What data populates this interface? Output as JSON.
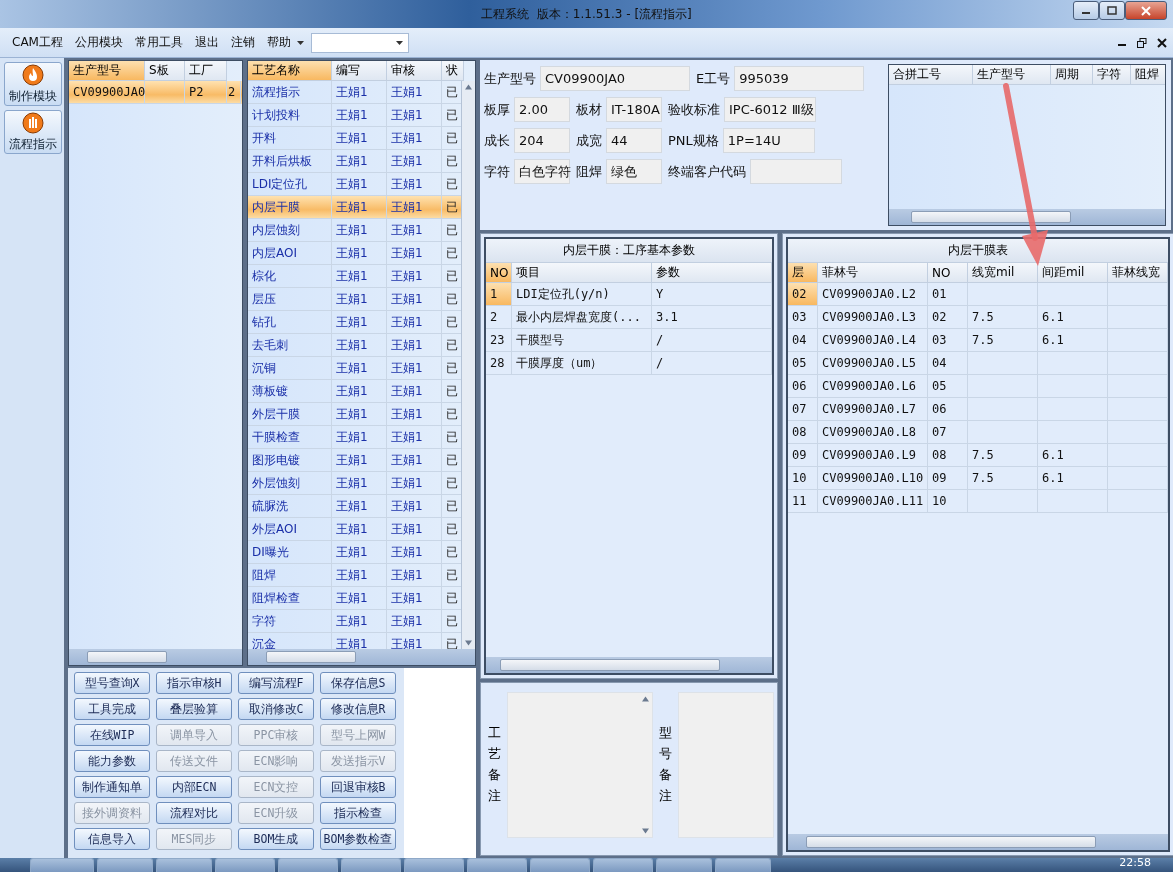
{
  "window": {
    "title": "工程系统  版本：1.1.51.3 - [流程指示]"
  },
  "menu": [
    "CAM工程",
    "公用模块",
    "常用工具",
    "退出",
    "注销",
    "帮助"
  ],
  "sidebar": [
    {
      "label": "制作模块"
    },
    {
      "label": "流程指示"
    }
  ],
  "model_grid": {
    "columns": [
      "生产型号",
      "S板",
      "工厂"
    ],
    "rows": [
      {
        "cells": [
          "CV09900JA0",
          "",
          "P2",
          "2"
        ],
        "selected": true
      }
    ]
  },
  "process_grid": {
    "columns": [
      "工艺名称",
      "编写",
      "审核",
      "状"
    ],
    "rows": [
      {
        "cells": [
          "流程指示",
          "王娟1",
          "王娟1",
          "已"
        ],
        "selected": false
      },
      {
        "cells": [
          "计划投料",
          "王娟1",
          "王娟1",
          "已"
        ],
        "selected": false
      },
      {
        "cells": [
          "开料",
          "王娟1",
          "王娟1",
          "已"
        ],
        "selected": false
      },
      {
        "cells": [
          "开料后烘板",
          "王娟1",
          "王娟1",
          "已"
        ],
        "selected": false
      },
      {
        "cells": [
          "LDI定位孔",
          "王娟1",
          "王娟1",
          "已"
        ],
        "selected": false
      },
      {
        "cells": [
          "内层干膜",
          "王娟1",
          "王娟1",
          "已"
        ],
        "selected": true
      },
      {
        "cells": [
          "内层蚀刻",
          "王娟1",
          "王娟1",
          "已"
        ],
        "selected": false
      },
      {
        "cells": [
          "内层AOI",
          "王娟1",
          "王娟1",
          "已"
        ],
        "selected": false
      },
      {
        "cells": [
          "棕化",
          "王娟1",
          "王娟1",
          "已"
        ],
        "selected": false
      },
      {
        "cells": [
          "层压",
          "王娟1",
          "王娟1",
          "已"
        ],
        "selected": false
      },
      {
        "cells": [
          "钻孔",
          "王娟1",
          "王娟1",
          "已"
        ],
        "selected": false
      },
      {
        "cells": [
          "去毛刺",
          "王娟1",
          "王娟1",
          "已"
        ],
        "selected": false
      },
      {
        "cells": [
          "沉铜",
          "王娟1",
          "王娟1",
          "已"
        ],
        "selected": false
      },
      {
        "cells": [
          "薄板镀",
          "王娟1",
          "王娟1",
          "已"
        ],
        "selected": false
      },
      {
        "cells": [
          "外层干膜",
          "王娟1",
          "王娟1",
          "已"
        ],
        "selected": false
      },
      {
        "cells": [
          "干膜检查",
          "王娟1",
          "王娟1",
          "已"
        ],
        "selected": false
      },
      {
        "cells": [
          "图形电镀",
          "王娟1",
          "王娟1",
          "已"
        ],
        "selected": false
      },
      {
        "cells": [
          "外层蚀刻",
          "王娟1",
          "王娟1",
          "已"
        ],
        "selected": false
      },
      {
        "cells": [
          "硫脲洗",
          "王娟1",
          "王娟1",
          "已"
        ],
        "selected": false
      },
      {
        "cells": [
          "外层AOI",
          "王娟1",
          "王娟1",
          "已"
        ],
        "selected": false
      },
      {
        "cells": [
          "DI曝光",
          "王娟1",
          "王娟1",
          "已"
        ],
        "selected": false
      },
      {
        "cells": [
          "阻焊",
          "王娟1",
          "王娟1",
          "已"
        ],
        "selected": false
      },
      {
        "cells": [
          "阻焊检查",
          "王娟1",
          "王娟1",
          "已"
        ],
        "selected": false
      },
      {
        "cells": [
          "字符",
          "王娟1",
          "王娟1",
          "已"
        ],
        "selected": false
      },
      {
        "cells": [
          "沉金",
          "王娟1",
          "王娟1",
          "已"
        ],
        "selected": false
      }
    ]
  },
  "buttons": [
    {
      "label": "型号查询X",
      "disabled": false
    },
    {
      "label": "指示审核H",
      "disabled": false
    },
    {
      "label": "编写流程F",
      "disabled": false
    },
    {
      "label": "保存信息S",
      "disabled": false
    },
    {
      "label": "工具完成",
      "disabled": false
    },
    {
      "label": "叠层验算",
      "disabled": false
    },
    {
      "label": "取消修改C",
      "disabled": false
    },
    {
      "label": "修改信息R",
      "disabled": false
    },
    {
      "label": "在线WIP",
      "disabled": false
    },
    {
      "label": "调单导入",
      "disabled": true
    },
    {
      "label": "PPC审核",
      "disabled": true
    },
    {
      "label": "型号上网W",
      "disabled": true
    },
    {
      "label": "能力参数",
      "disabled": false
    },
    {
      "label": "传送文件",
      "disabled": true
    },
    {
      "label": "ECN影响",
      "disabled": true
    },
    {
      "label": "发送指示V",
      "disabled": true
    },
    {
      "label": "制作通知单",
      "disabled": false
    },
    {
      "label": "内部ECN",
      "disabled": false
    },
    {
      "label": "ECN文控",
      "disabled": true
    },
    {
      "label": "回退审核B",
      "disabled": false
    },
    {
      "label": "接外调资料",
      "disabled": true
    },
    {
      "label": "流程对比",
      "disabled": false
    },
    {
      "label": "ECN升级",
      "disabled": true
    },
    {
      "label": "指示检查",
      "disabled": false
    },
    {
      "label": "信息导入",
      "disabled": false
    },
    {
      "label": "MES同步",
      "disabled": true
    },
    {
      "label": "BOM生成",
      "disabled": false
    },
    {
      "label": "BOM参数检查",
      "disabled": false
    }
  ],
  "form": [
    [
      {
        "label": "生产型号",
        "value": "CV09900JA0"
      },
      {
        "label": "E工号",
        "value": "995039"
      }
    ],
    [
      {
        "label": "板厚",
        "value": "2.00"
      },
      {
        "label": "板材",
        "value": "IT-180A"
      },
      {
        "label": "验收标准",
        "value": "IPC-6012 Ⅲ级"
      }
    ],
    [
      {
        "label": "成长",
        "value": "204"
      },
      {
        "label": "成宽",
        "value": "44"
      },
      {
        "label": "PNL规格",
        "value": "1P=14U"
      }
    ],
    [
      {
        "label": "字符",
        "value": "白色字符"
      },
      {
        "label": "阻焊",
        "value": "绿色"
      },
      {
        "label": "终端客户代码"
      }
    ]
  ],
  "merge_grid": {
    "columns": [
      "合拼工号",
      "生产型号",
      "周期",
      "字符",
      "阻焊"
    ]
  },
  "params_table": {
    "title": "内层干膜：工序基本参数",
    "columns": [
      "NO",
      "项目",
      "参数"
    ],
    "rows": [
      {
        "cells": [
          "1",
          "LDI定位孔(y/n)",
          "Y"
        ],
        "selected": true
      },
      {
        "cells": [
          "2",
          "最小内层焊盘宽度(...",
          "3.1"
        ],
        "selected": false
      },
      {
        "cells": [
          "23",
          "干膜型号",
          "/"
        ],
        "selected": false
      },
      {
        "cells": [
          "28",
          "干膜厚度（um）",
          "/"
        ],
        "selected": false
      }
    ]
  },
  "layer_table": {
    "title": "内层干膜表",
    "columns": [
      "层",
      "菲林号",
      "NO",
      "线宽mil",
      "间距mil",
      "菲林线宽"
    ],
    "rows": [
      {
        "cells": [
          "02",
          "CV09900JA0.L2",
          "01",
          "",
          ""
        ],
        "selected": true
      },
      {
        "cells": [
          "03",
          "CV09900JA0.L3",
          "02",
          "7.5",
          "6.1"
        ],
        "selected": false
      },
      {
        "cells": [
          "04",
          "CV09900JA0.L4",
          "03",
          "7.5",
          "6.1"
        ],
        "selected": false
      },
      {
        "cells": [
          "05",
          "CV09900JA0.L5",
          "04",
          "",
          ""
        ],
        "selected": false
      },
      {
        "cells": [
          "06",
          "CV09900JA0.L6",
          "05",
          "",
          ""
        ],
        "selected": false
      },
      {
        "cells": [
          "07",
          "CV09900JA0.L7",
          "06",
          "",
          ""
        ],
        "selected": false
      },
      {
        "cells": [
          "08",
          "CV09900JA0.L8",
          "07",
          "",
          ""
        ],
        "selected": false
      },
      {
        "cells": [
          "09",
          "CV09900JA0.L9",
          "08",
          "7.5",
          "6.1"
        ],
        "selected": false
      },
      {
        "cells": [
          "10",
          "CV09900JA0.L10",
          "09",
          "7.5",
          "6.1"
        ],
        "selected": false
      },
      {
        "cells": [
          "11",
          "CV09900JA0.L11",
          "10",
          "",
          ""
        ],
        "selected": false
      }
    ]
  },
  "notes": [
    {
      "label": "工艺备注"
    },
    {
      "label": "型号备注"
    }
  ],
  "taskbar": {
    "clock": "22:58"
  }
}
